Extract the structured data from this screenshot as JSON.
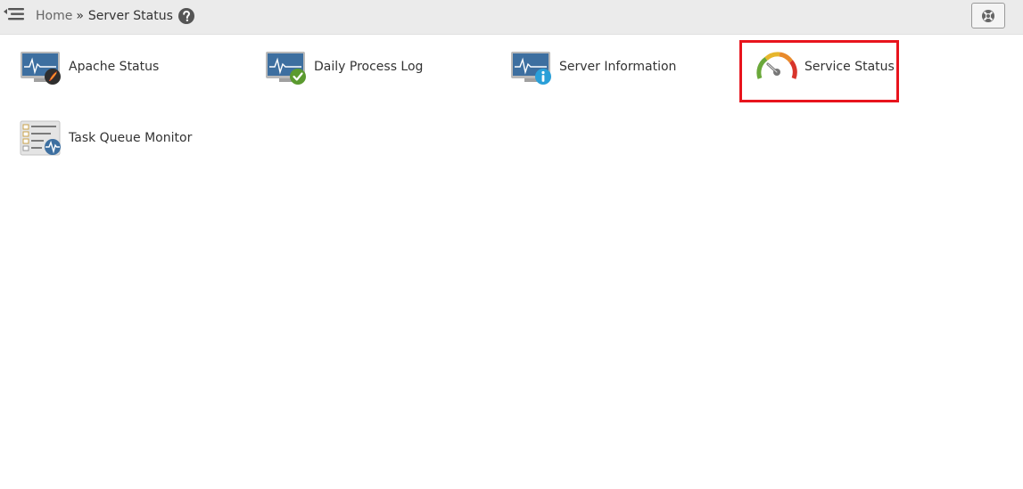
{
  "header": {
    "breadcrumb": {
      "home": "Home",
      "separator": "»",
      "current": "Server Status"
    },
    "icons": {
      "nav_toggle": "menu-collapse-icon",
      "help": "question-circle-icon",
      "close": "lifebuoy-close-icon"
    }
  },
  "tiles": [
    {
      "label": "Apache Status",
      "icon": "monitor-feather-icon"
    },
    {
      "label": "Daily Process Log",
      "icon": "monitor-check-icon"
    },
    {
      "label": "Server Information",
      "icon": "monitor-info-icon"
    },
    {
      "label": "Service Status",
      "icon": "gauge-icon",
      "highlighted": true
    },
    {
      "label": "Task Queue Monitor",
      "icon": "checklist-pulse-icon"
    }
  ],
  "colors": {
    "highlight": "#e8141d",
    "header_bg": "#ebebeb",
    "monitor_blue": "#3d6fa0",
    "check_green": "#5b9a2f",
    "info_blue": "#2a9fd8"
  }
}
